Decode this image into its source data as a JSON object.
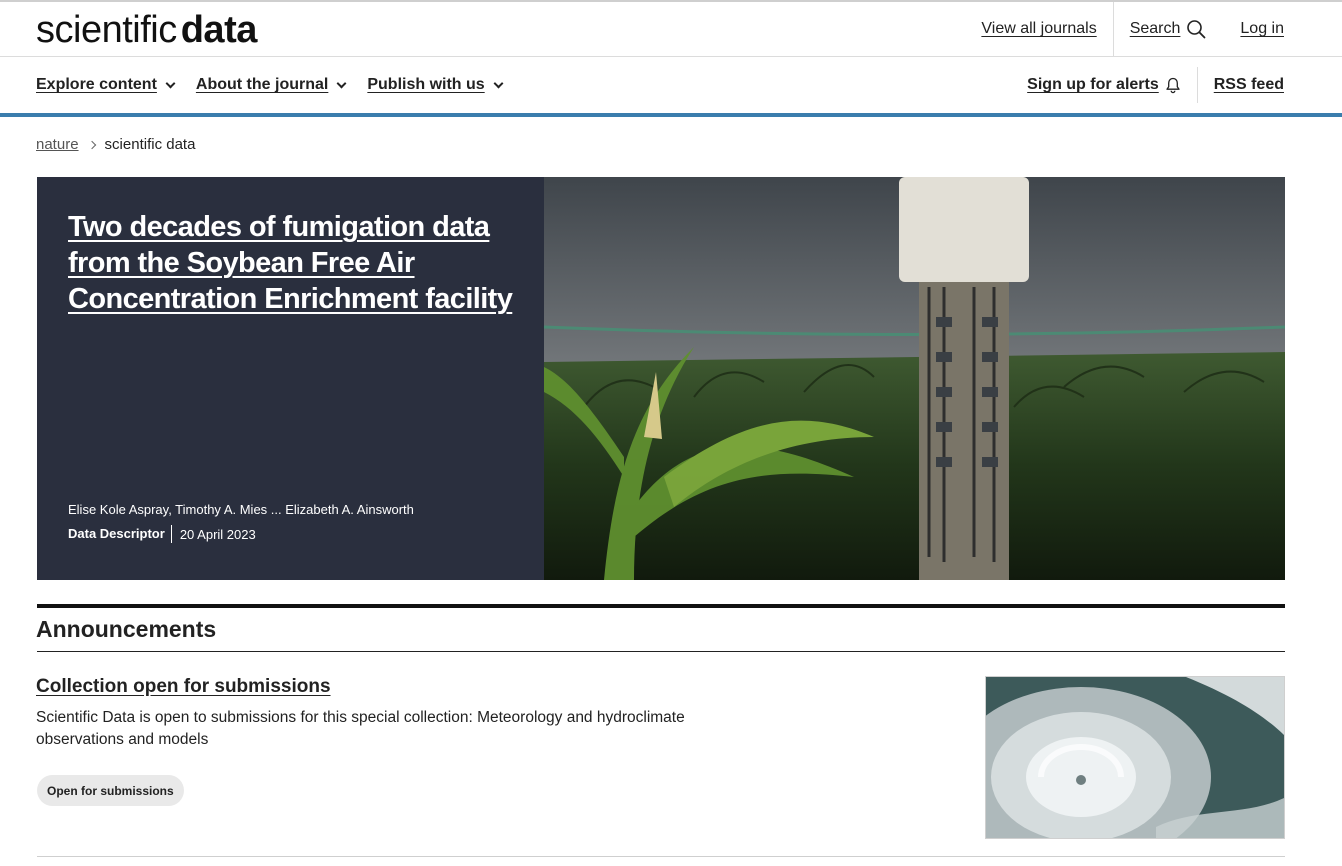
{
  "header": {
    "logo_light": "scientific",
    "logo_bold": "data",
    "view_all_journals": "View all journals",
    "search_label": "Search",
    "login_label": "Log in"
  },
  "nav": {
    "items": [
      {
        "label": "Explore content"
      },
      {
        "label": "About the journal"
      },
      {
        "label": "Publish with us"
      }
    ],
    "alerts_label": "Sign up for alerts",
    "rss_label": "RSS feed"
  },
  "breadcrumb": {
    "root": "nature",
    "current": "scientific data"
  },
  "hero": {
    "title": "Two decades of fumigation data from the Soybean Free Air Concentration Enrichment facility",
    "authors": "Elise Kole Aspray, Timothy A. Mies ... Elizabeth A. Ainsworth",
    "article_type": "Data Descriptor",
    "date": "20 April 2023"
  },
  "announcements": {
    "heading": "Announcements",
    "item": {
      "title": "Collection open for submissions",
      "description": "Scientific Data is open to submissions for this special collection: Meteorology and hydroclimate observations and models",
      "badge": "Open for submissions"
    }
  },
  "colors": {
    "accent_blue": "#3a7dad",
    "hero_panel": "#2a2f3e"
  }
}
